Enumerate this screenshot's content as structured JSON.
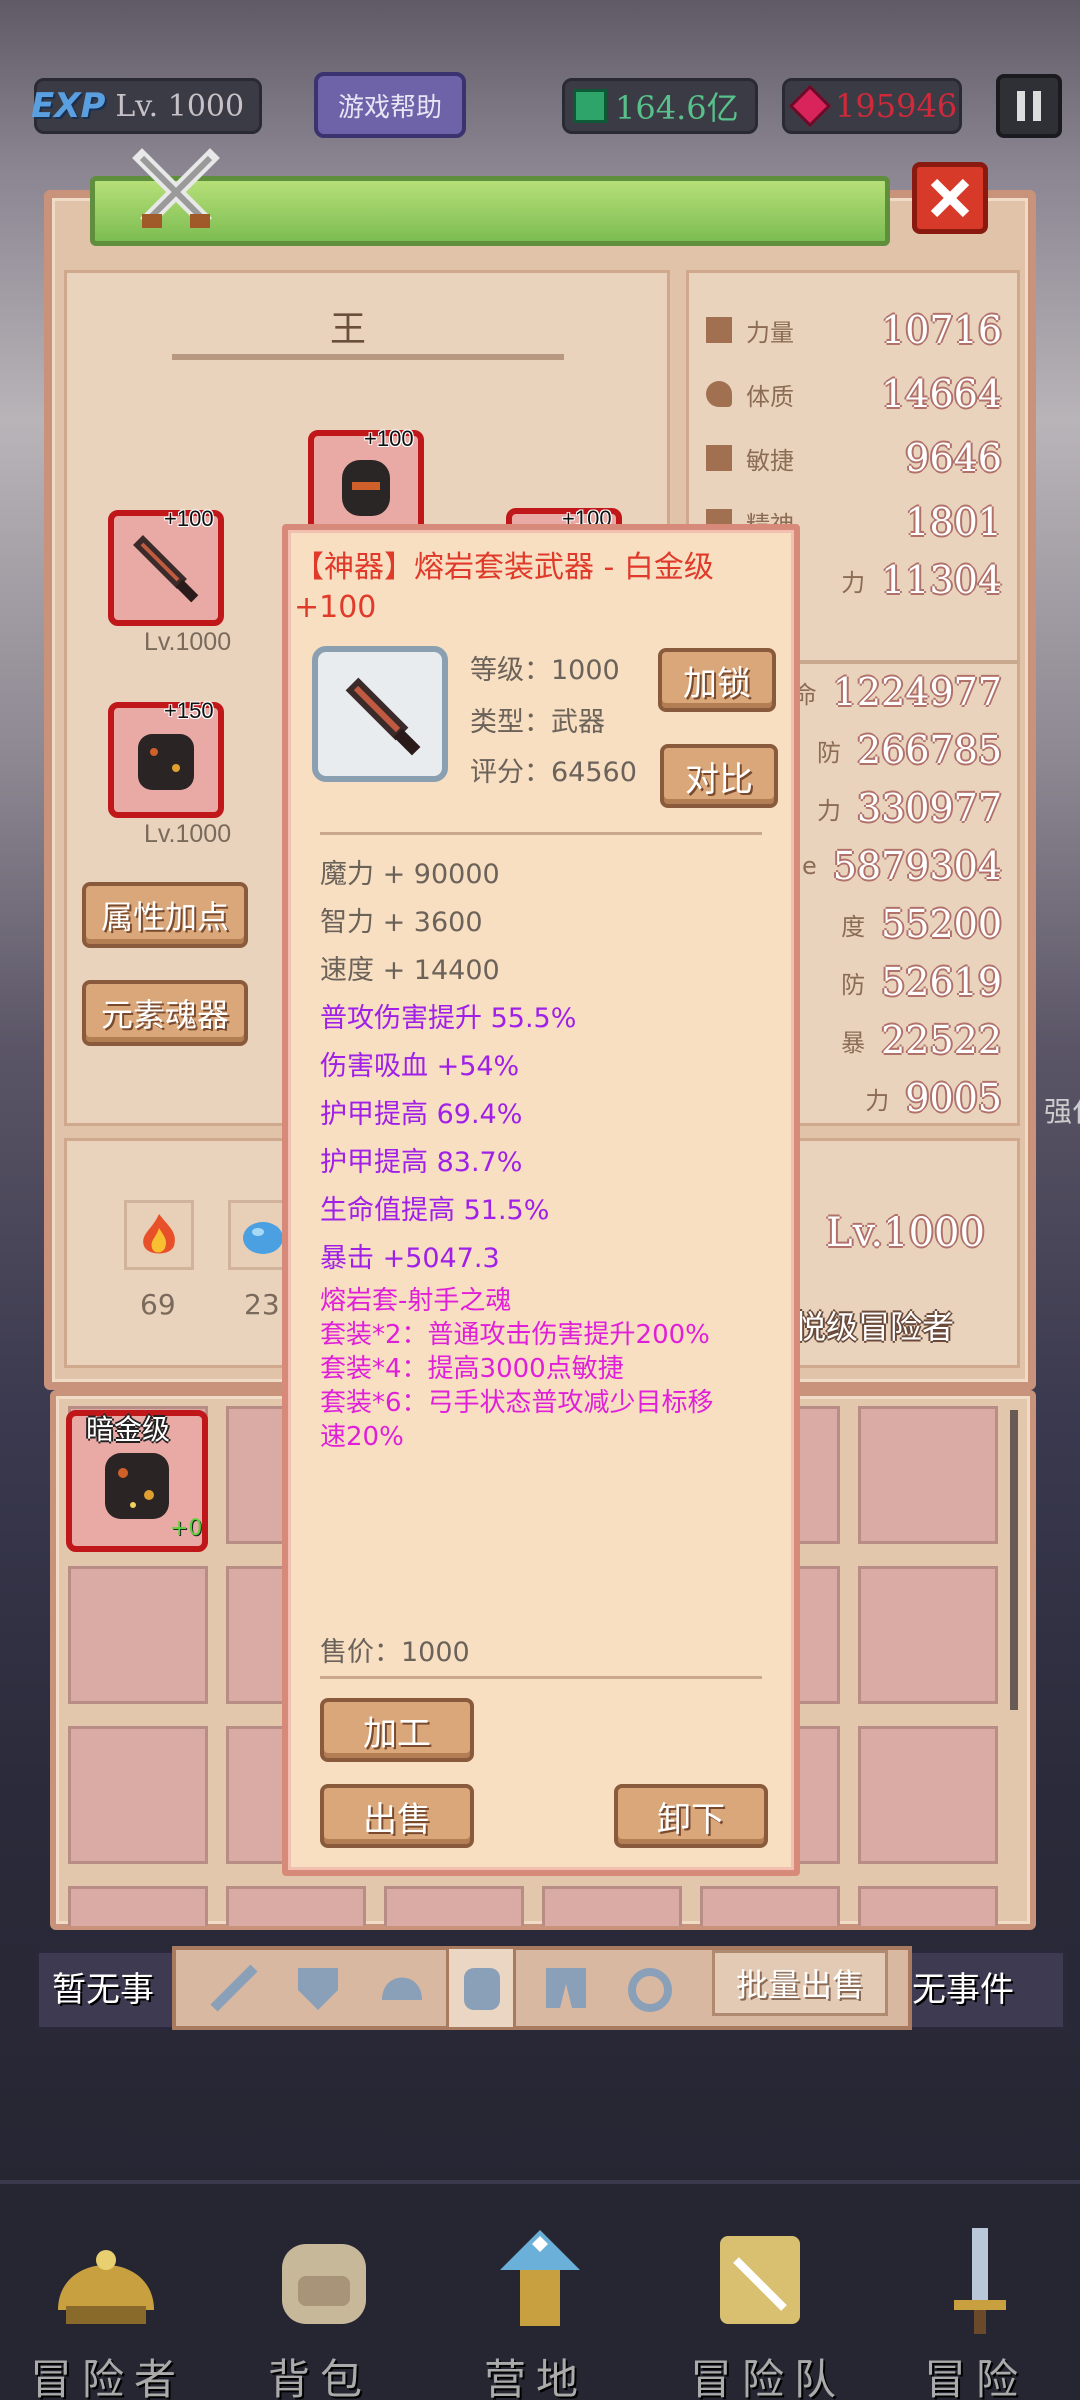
{
  "topbar": {
    "exp_label": "EXP",
    "level": "Lv. 1000",
    "help_label": "游戏帮助",
    "gems": "164.6亿",
    "rubies": "195946"
  },
  "equipment": {
    "slot_title": "王",
    "items": [
      {
        "plus": "+100",
        "level": "Lv.1000"
      },
      {
        "plus": "+100"
      },
      {
        "plus": "+150",
        "level": "Lv.1000"
      },
      {
        "plus": "+100"
      }
    ],
    "attr_button": "属性加点",
    "element_button": "元素魂器",
    "elements": [
      {
        "count": "69"
      },
      {
        "count": "23"
      }
    ]
  },
  "stats": {
    "base": [
      {
        "name": "力量",
        "value": "10716"
      },
      {
        "name": "体质",
        "value": "14664"
      },
      {
        "name": "敏捷",
        "value": "9646"
      },
      {
        "name": "精神",
        "value": "1801"
      },
      {
        "name": "力",
        "value": "11304"
      }
    ],
    "secondary": [
      {
        "name": "命",
        "value": "1224977"
      },
      {
        "name": "防",
        "value": "266785"
      },
      {
        "name": "力",
        "value": "330977"
      },
      {
        "name": "e",
        "value": "5879304"
      },
      {
        "name": "度",
        "value": "55200"
      },
      {
        "name": "防",
        "value": "52619"
      },
      {
        "name": "暴",
        "value": "22522"
      },
      {
        "name": "力",
        "value": "9005"
      }
    ],
    "adventurer_level": "Lv.1000",
    "adventurer_title": "悦级冒险者"
  },
  "side_text": {
    "right": "强化"
  },
  "popup": {
    "title": "【神器】熔岩套装武器 - 白金级",
    "title_plus": "+100",
    "level": "等级：1000",
    "type": "类型：武器",
    "score": "评分：64560",
    "lock_button": "加锁",
    "compare_button": "对比",
    "stats": [
      "魔力 + 90000",
      "智力 + 3600",
      "速度 + 14400"
    ],
    "bonuses": [
      "普攻伤害提升 55.5%",
      "伤害吸血 +54%",
      "护甲提高 69.4%",
      "护甲提高 83.7%",
      "生命值提高 51.5%",
      "暴击 +5047.3"
    ],
    "set_lines": [
      "熔岩套-射手之魂",
      "套装*2：普通攻击伤害提升200%",
      "套装*4：提高3000点敏捷",
      "套装*6：弓手状态普攻减少目标移",
      "速20%"
    ],
    "price": "售价：1000",
    "craft_button": "加工",
    "sell_button": "出售",
    "unequip_button": "卸下"
  },
  "inventory": {
    "first_item_label": "暗金级",
    "first_item_plus": "+0"
  },
  "bottom_tabs": {
    "left_label": "暂无事",
    "batch_sell": "批量出售",
    "right_label": "无事件"
  },
  "nav": [
    {
      "label": "冒险者",
      "icon": "helmet-icon"
    },
    {
      "label": "背包",
      "icon": "backpack-icon"
    },
    {
      "label": "营地",
      "icon": "camp-icon"
    },
    {
      "label": "冒险队",
      "icon": "book-icon"
    },
    {
      "label": "冒险",
      "icon": "sword-icon"
    }
  ],
  "colors": {
    "frame": "#c69477",
    "panel": "#e2c7ad",
    "popup": "#f8dfc2",
    "title_red": "#e03a2a",
    "purple": "#a020e8",
    "magenta": "#e020d8",
    "equip_border": "#c0171b"
  }
}
